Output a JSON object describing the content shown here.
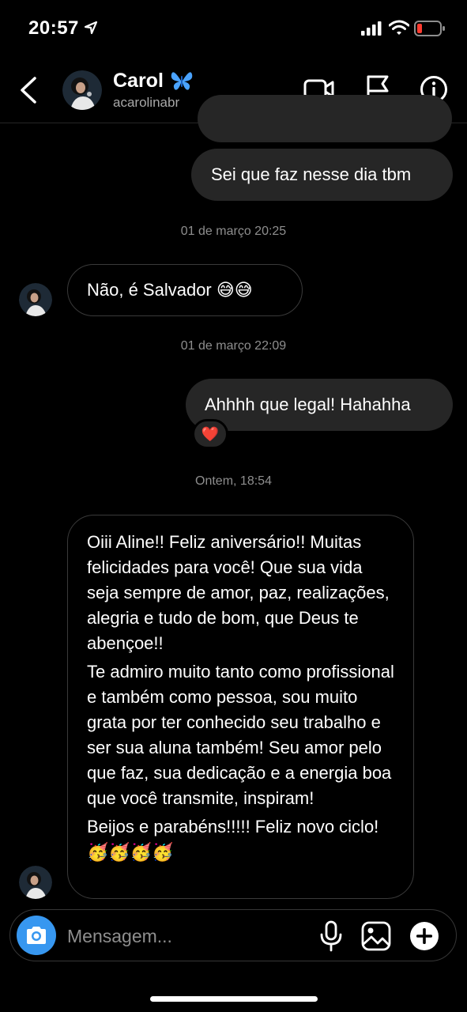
{
  "status_bar": {
    "time": "20:57"
  },
  "header": {
    "contact_name": "Carol",
    "contact_handle": "acarolinabr"
  },
  "messages": [
    {
      "id": "partial",
      "text": ""
    },
    {
      "id": "m1",
      "direction": "outgoing",
      "text": "Sei que faz nesse dia tbm"
    },
    {
      "id": "ts1",
      "timestamp": "01 de março 20:25"
    },
    {
      "id": "m2",
      "direction": "incoming",
      "text": "Não, é Salvador 😅😅"
    },
    {
      "id": "ts2",
      "timestamp": "01 de março 22:09"
    },
    {
      "id": "m3",
      "direction": "outgoing",
      "text": "Ahhhh que legal! Hahahha",
      "reaction": "❤️"
    },
    {
      "id": "ts3",
      "timestamp": "Ontem, 18:54"
    },
    {
      "id": "m4",
      "direction": "incoming",
      "paragraphs": [
        "Oiii Aline!! Feliz aniversário!! Muitas felicidades para você! Que sua vida seja sempre de amor, paz, realizações, alegria e tudo de bom, que Deus te abençoe!!",
        "Te admiro muito tanto como profissional e também como pessoa, sou muito grata por ter conhecido seu trabalho e ser sua aluna também! Seu amor pelo que faz, sua dedicação e a energia boa que você transmite, inspiram!",
        "Beijos e parabéns!!!!! Feliz novo ciclo! 🥳🥳🥳🥳"
      ]
    }
  ],
  "composer": {
    "placeholder": "Mensagem..."
  },
  "icons": {
    "back": "chevron-left-icon",
    "video": "video-camera-icon",
    "flag": "flag-icon",
    "info": "info-icon",
    "camera": "camera-icon",
    "mic": "microphone-icon",
    "gallery": "image-icon",
    "plus": "plus-circle-icon"
  },
  "colors": {
    "accent": "#3797f0",
    "bubble_outgoing": "#262626",
    "battery_low": "#ff3b30"
  }
}
